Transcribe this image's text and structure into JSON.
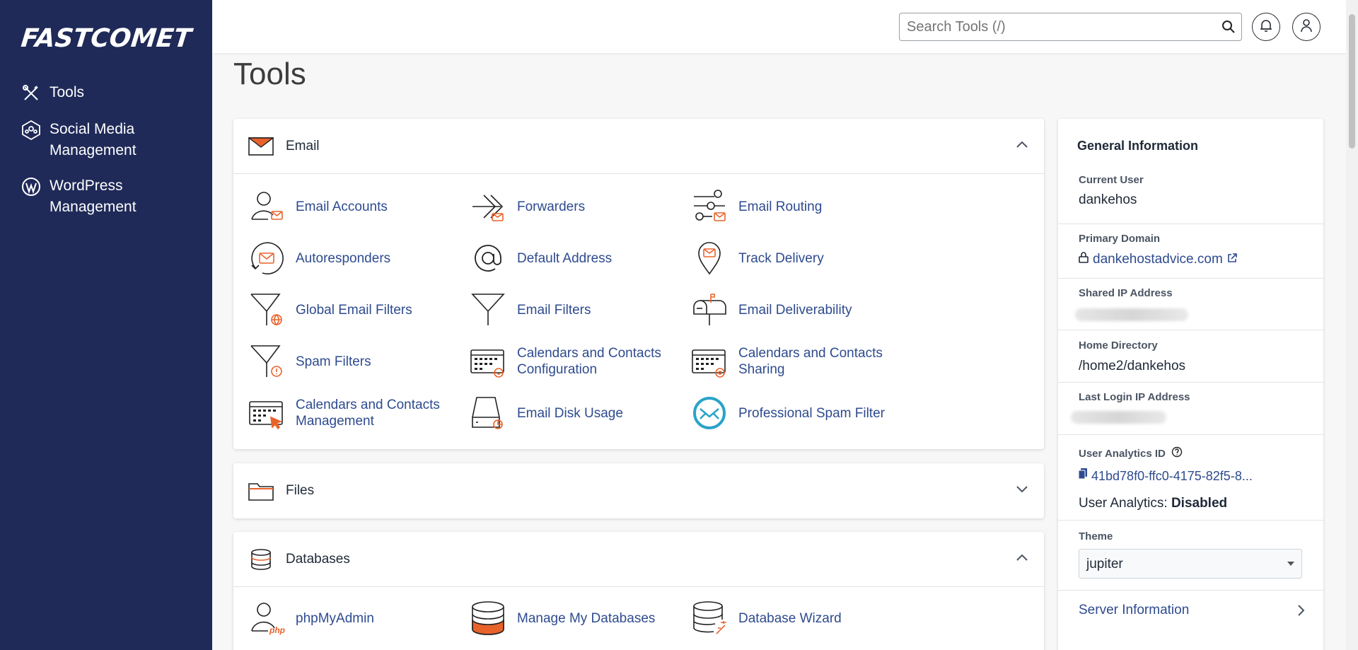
{
  "brand": {
    "logo_text": "FASTCOMET"
  },
  "sidebar": {
    "items": [
      {
        "label": "Tools",
        "icon": "tools-icon"
      },
      {
        "label": "Social Media Management",
        "icon": "social-media-icon"
      },
      {
        "label": "WordPress Management",
        "icon": "wordpress-icon"
      }
    ]
  },
  "topbar": {
    "search_placeholder": "Search Tools (/)"
  },
  "page": {
    "title": "Tools"
  },
  "sections": {
    "email": {
      "title": "Email",
      "expanded": true,
      "tools": [
        {
          "label": "Email Accounts",
          "icon": "email-accounts-icon"
        },
        {
          "label": "Forwarders",
          "icon": "forwarders-icon"
        },
        {
          "label": "Email Routing",
          "icon": "email-routing-icon"
        },
        {
          "label": "Autoresponders",
          "icon": "autoresponders-icon"
        },
        {
          "label": "Default Address",
          "icon": "default-address-icon"
        },
        {
          "label": "Track Delivery",
          "icon": "track-delivery-icon"
        },
        {
          "label": "Global Email Filters",
          "icon": "global-email-filters-icon"
        },
        {
          "label": "Email Filters",
          "icon": "email-filters-icon"
        },
        {
          "label": "Email Deliverability",
          "icon": "email-deliverability-icon"
        },
        {
          "label": "Spam Filters",
          "icon": "spam-filters-icon"
        },
        {
          "label": "Calendars and Contacts Configuration",
          "icon": "calendars-config-icon"
        },
        {
          "label": "Calendars and Contacts Sharing",
          "icon": "calendars-sharing-icon"
        },
        {
          "label": "Calendars and Contacts Management",
          "icon": "calendars-management-icon"
        },
        {
          "label": "Email Disk Usage",
          "icon": "email-disk-usage-icon"
        },
        {
          "label": "Professional Spam Filter",
          "icon": "professional-spam-filter-icon"
        }
      ]
    },
    "files": {
      "title": "Files",
      "expanded": false
    },
    "databases": {
      "title": "Databases",
      "expanded": true,
      "tools": [
        {
          "label": "phpMyAdmin",
          "icon": "phpmyadmin-icon"
        },
        {
          "label": "Manage My Databases",
          "icon": "manage-databases-icon"
        },
        {
          "label": "Database Wizard",
          "icon": "database-wizard-icon"
        }
      ]
    }
  },
  "general_info": {
    "title": "General Information",
    "current_user_label": "Current User",
    "current_user": "dankehos",
    "primary_domain_label": "Primary Domain",
    "primary_domain": "dankehostadvice.com",
    "shared_ip_label": "Shared IP Address",
    "home_dir_label": "Home Directory",
    "home_dir": "/home2/dankehos",
    "last_login_label": "Last Login IP Address",
    "analytics_id_label": "User Analytics ID",
    "analytics_id": "41bd78f0-ffc0-4175-82f5-8...",
    "analytics_status_label": "User Analytics:",
    "analytics_status": "Disabled",
    "theme_label": "Theme",
    "theme_value": "jupiter",
    "server_info": "Server Information"
  },
  "colors": {
    "sidebar": "#1f2a58",
    "accent": "#e8632c",
    "link": "#2e4b8f"
  }
}
